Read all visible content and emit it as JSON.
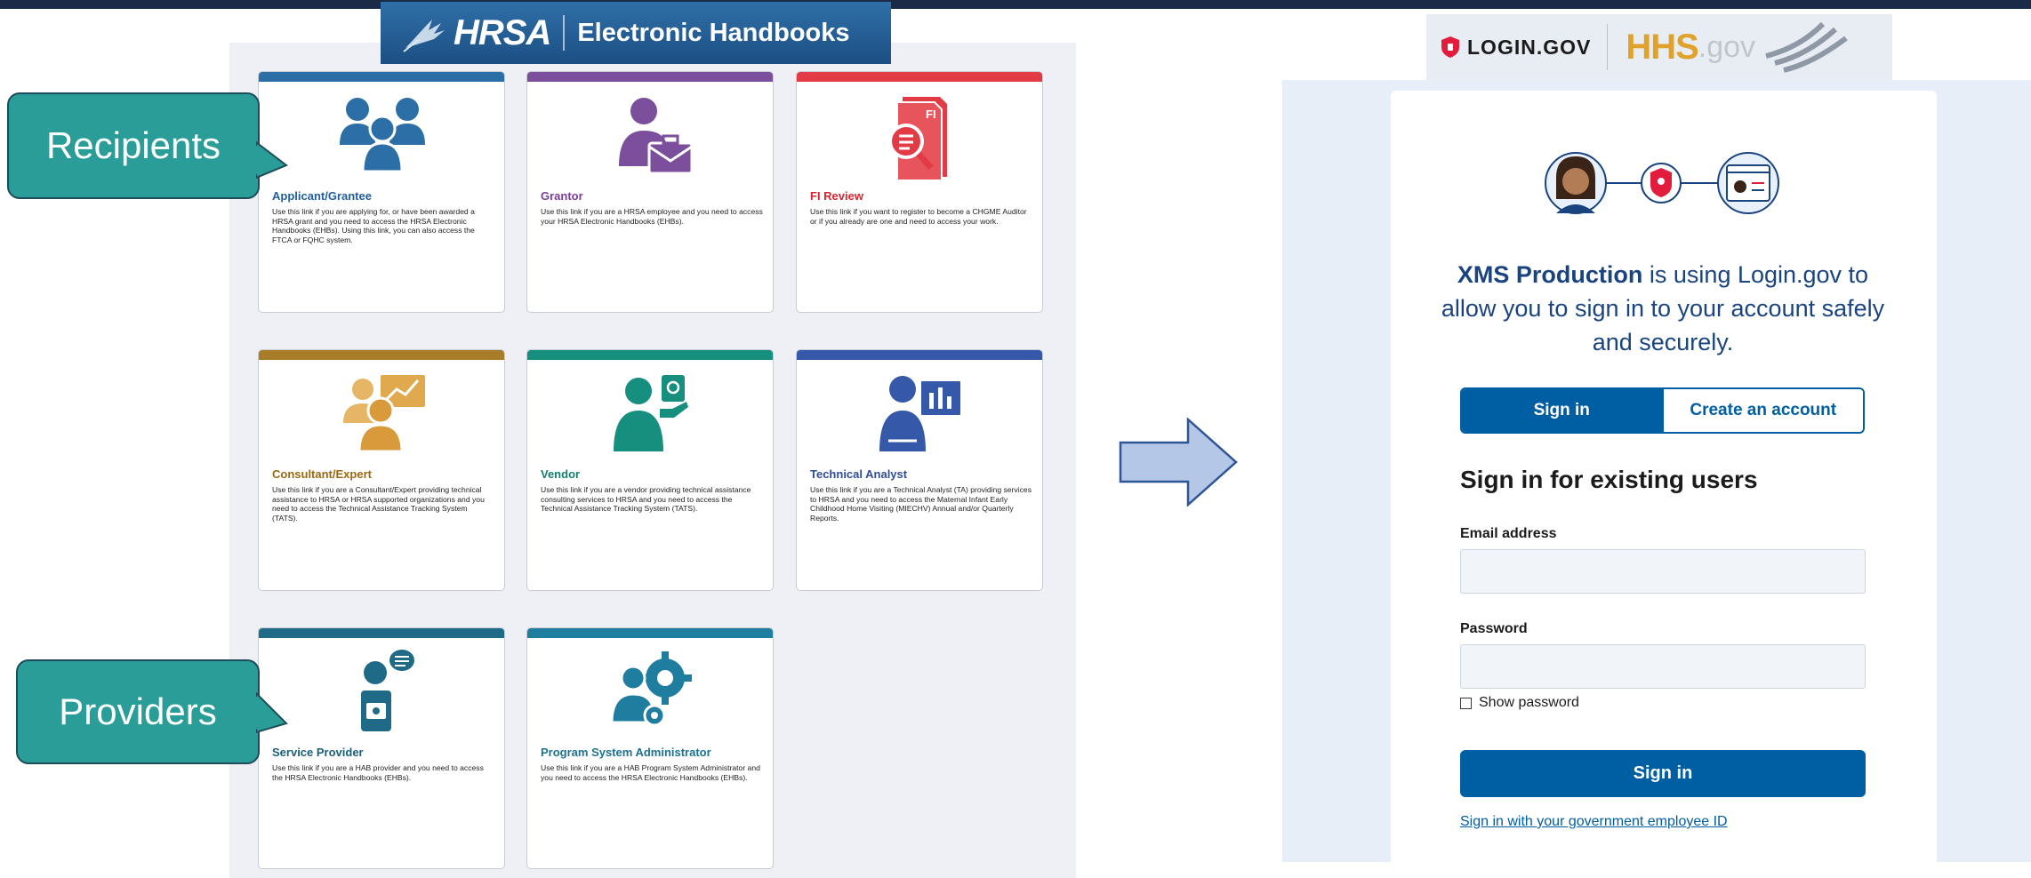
{
  "ehb": {
    "header_logo": "HRSA",
    "header_title": "Electronic Handbooks",
    "cards": [
      {
        "title": "Applicant/Grantee",
        "description": "Use this link if you are applying for, or have been awarded a HRSA grant and you need to access the HRSA Electronic Handbooks (EHBs). Using this link, you can also access the FTCA or FQHC system.",
        "color": "#2b6fa6",
        "title_color": "#1f5fa0",
        "icon": "people-group-icon"
      },
      {
        "title": "Grantor",
        "description": "Use this link if you are a HRSA employee and you need to access your HRSA Electronic Handbooks (EHBs).",
        "color": "#7b4f9c",
        "title_color": "#7b3f9c",
        "icon": "person-briefcase-icon"
      },
      {
        "title": "FI Review",
        "description": "Use this link if you want to register to become a CHGME Auditor or if you already are one and need to access your work.",
        "color": "#e23b46",
        "title_color": "#d8262f",
        "icon": "document-magnifier-icon"
      },
      {
        "title": "Consultant/Expert",
        "description": "Use this link if you are a Consultant/Expert providing technical assistance to HRSA or HRSA supported organizations and you need to access the Technical Assistance Tracking System (TATS).",
        "color": "#a87d2a",
        "title_color": "#9a6a12",
        "icon": "consultant-chart-icon"
      },
      {
        "title": "Vendor",
        "description": "Use this link if you are a vendor providing technical assistance consulting services to HRSA and you need to access the Technical Assistance Tracking System (TATS).",
        "color": "#178f7e",
        "title_color": "#14806f",
        "icon": "vendor-person-icon"
      },
      {
        "title": "Technical Analyst",
        "description": "Use this link if you are a Technical Analyst (TA) providing services to HRSA and you need to access the Maternal Infant Early Childhood Home Visiting (MIECHV) Annual and/or Quarterly Reports.",
        "color": "#3558a8",
        "title_color": "#2f4d98",
        "icon": "analyst-screen-icon"
      },
      {
        "title": "Service Provider",
        "description": "Use this link if you are a HAB provider and you need to access the HRSA Electronic Handbooks (EHBs).",
        "color": "#1f6a86",
        "title_color": "#1a5f7a",
        "icon": "service-provider-icon"
      },
      {
        "title": "Program System Administrator",
        "description": "Use this link if you are a HAB Program System Administrator and you need to access the HRSA Electronic Handbooks (EHBs).",
        "color": "#1f7ea0",
        "title_color": "#1d7190",
        "icon": "admin-gears-icon"
      }
    ]
  },
  "callouts": {
    "recipients": "Recipients",
    "providers": "Providers"
  },
  "login": {
    "brand_login": "LOGIN.GOV",
    "brand_hhs": "HHS",
    "brand_gov": ".gov",
    "app_name": "XMS Production",
    "intro_rest": " is using Login.gov to allow you to sign in to your account safely and securely.",
    "tab_signin": "Sign in",
    "tab_create": "Create an account",
    "heading": "Sign in for existing users",
    "email_label": "Email address",
    "password_label": "Password",
    "show_password": "Show password",
    "signin_button": "Sign in",
    "gov_link": "Sign in with your government employee ID"
  }
}
